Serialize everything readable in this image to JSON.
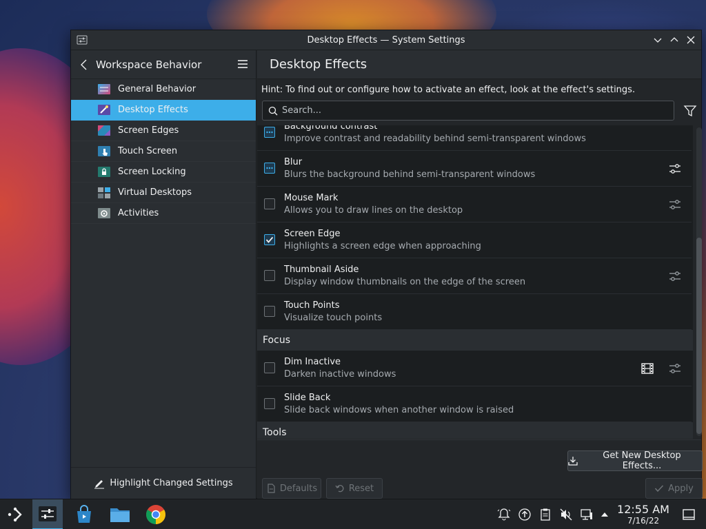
{
  "window": {
    "title": "Desktop Effects — System Settings"
  },
  "sidebar": {
    "header": "Workspace Behavior",
    "items": [
      {
        "label": "General Behavior",
        "color": "#3daee9"
      },
      {
        "label": "Desktop Effects",
        "color": "#8a5cc4"
      },
      {
        "label": "Screen Edges",
        "color": "#d44a7a"
      },
      {
        "label": "Touch Screen",
        "color": "#3daee9"
      },
      {
        "label": "Screen Locking",
        "color": "#2a9a8a"
      },
      {
        "label": "Virtual Desktops",
        "color": "#7f8c8d"
      },
      {
        "label": "Activities",
        "color": "#95a5a6"
      }
    ],
    "active_index": 1,
    "footer": "Highlight Changed Settings"
  },
  "main": {
    "title": "Desktop Effects",
    "hint": "Hint: To find out or configure how to activate an effect, look at the effect's settings.",
    "search_placeholder": "Search...",
    "groups": [
      {
        "effects": [
          {
            "name": "Background contrast",
            "desc": "Improve contrast and readability behind semi-transparent windows",
            "state": "partial",
            "configurable": false
          },
          {
            "name": "Blur",
            "desc": "Blurs the background behind semi-transparent windows",
            "state": "partial",
            "configurable": true
          },
          {
            "name": "Mouse Mark",
            "desc": "Allows you to draw lines on the desktop",
            "state": "off",
            "configurable": true
          },
          {
            "name": "Screen Edge",
            "desc": "Highlights a screen edge when approaching",
            "state": "on",
            "configurable": false
          },
          {
            "name": "Thumbnail Aside",
            "desc": "Display window thumbnails on the edge of the screen",
            "state": "off",
            "configurable": true
          },
          {
            "name": "Touch Points",
            "desc": "Visualize touch points",
            "state": "off",
            "configurable": false
          }
        ]
      },
      {
        "section": "Focus",
        "effects": [
          {
            "name": "Dim Inactive",
            "desc": "Darken inactive windows",
            "state": "off",
            "configurable": true,
            "video": true
          },
          {
            "name": "Slide Back",
            "desc": "Slide back windows when another window is raised",
            "state": "off",
            "configurable": false
          }
        ]
      },
      {
        "section": "Tools",
        "effects": []
      }
    ],
    "get_new_label": "Get New Desktop Effects...",
    "defaults_label": "Defaults",
    "reset_label": "Reset",
    "apply_label": "Apply"
  },
  "taskbar": {
    "time": "12:55 AM",
    "date": "7/16/22"
  },
  "colors": {
    "accent": "#3daee9",
    "window_bg": "#232629",
    "list_bg": "#1b1e20"
  }
}
